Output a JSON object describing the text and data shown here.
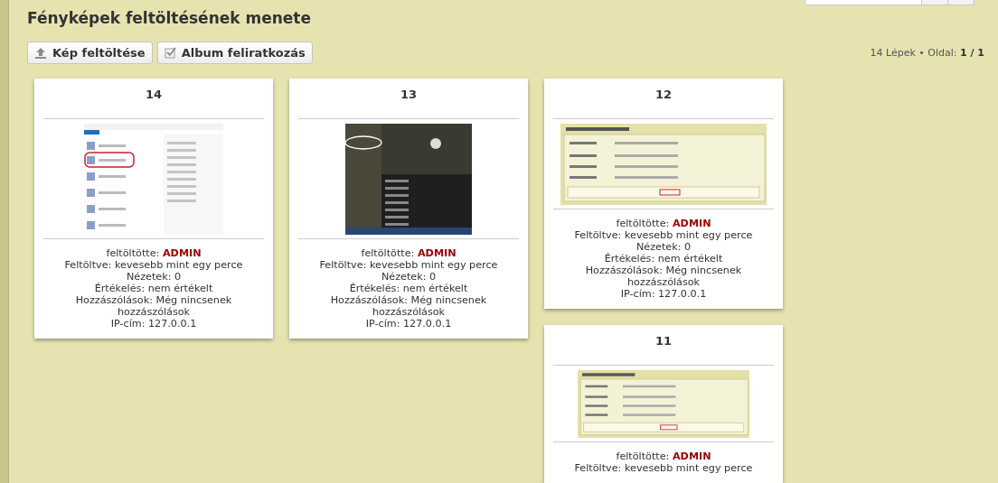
{
  "title": "Fényképek feltöltésének menete",
  "toolbar": {
    "buttons": [
      {
        "kind": "upload",
        "label": "Kép feltöltése"
      },
      {
        "kind": "subscribe",
        "label": "Album feliratkozás"
      }
    ]
  },
  "pager": {
    "count": "14 Lépek",
    "separator": "•",
    "page_label": "Oldal:",
    "page": "1 / 1"
  },
  "photos": [
    {
      "number": "14",
      "kind": "menu",
      "uploader_label": "feltöltötte:",
      "uploader": "ADMIN",
      "lines": [
        "Feltöltve: kevesebb mint egy perce",
        "Nézetek: 0",
        "Értékelés: nem értékelt",
        "Hozzászólások: Még nincsenek hozzászólások",
        "IP-cím: 127.0.0.1"
      ]
    },
    {
      "number": "13",
      "kind": "dark",
      "uploader_label": "feltöltötte:",
      "uploader": "ADMIN",
      "lines": [
        "Feltöltve: kevesebb mint egy perce",
        "Nézetek: 0",
        "Értékelés: nem értékelt",
        "Hozzászólások: Még nincsenek hozzászólások",
        "IP-cím: 127.0.0.1"
      ]
    },
    {
      "number": "12",
      "kind": "form",
      "uploader_label": "feltöltötte:",
      "uploader": "ADMIN",
      "lines": [
        "Feltöltve: kevesebb mint egy perce",
        "Nézetek: 0",
        "Értékelés: nem értékelt",
        "Hozzászólások: Még nincsenek hozzászólások",
        "IP-cím: 127.0.0.1"
      ]
    },
    {
      "number": "11",
      "kind": "form-small",
      "uploader_label": "feltöltötte:",
      "uploader": "ADMIN",
      "lines": [
        "Feltöltve: kevesebb mint egy perce"
      ]
    }
  ]
}
